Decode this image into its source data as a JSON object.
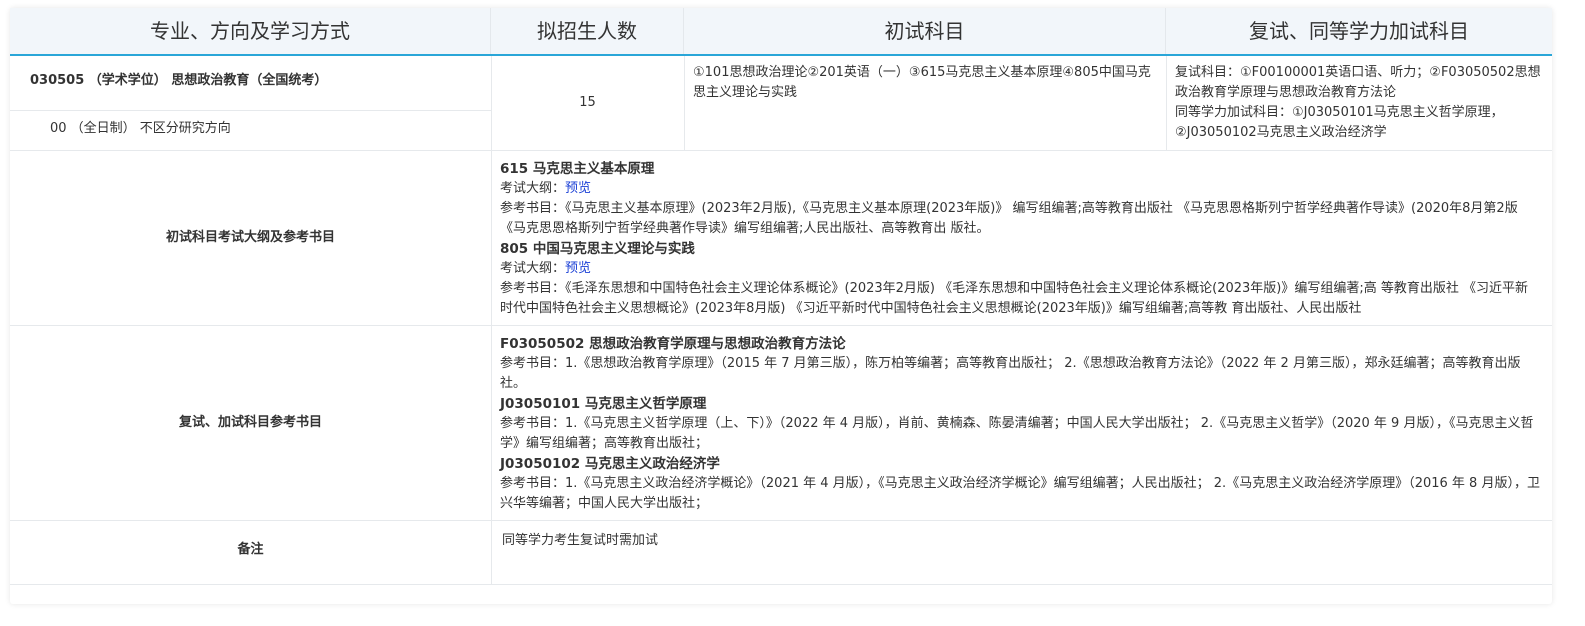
{
  "header": {
    "col1": "专业、方向及学习方式",
    "col2": "拟招生人数",
    "col3": "初试科目",
    "col4": "复试、同等学力加试科目"
  },
  "program": {
    "major": "030505 （学术学位） 思想政治教育（全国统考）",
    "direction": "00 （全日制） 不区分研究方向",
    "quota": "15",
    "exam_subjects": "①101思想政治理论②201英语（一）③615马克思主义基本原理④805中国马克思主义理论与实践",
    "retest_line1": "复试科目：①F00100001英语口语、听力；②F03050502思想政治教育学原理与思想政治教育方法论",
    "retest_line2": "同等学力加试科目：①J03050101马克思主义哲学原理，②J03050102马克思主义政治经济学"
  },
  "section1": {
    "label": "初试科目考试大纲及参考书目",
    "s1_title": "615 马克思主义基本原理",
    "s1_outline_label": "考试大纲：",
    "s1_outline_link": "预览",
    "s1_books": "参考书目：《马克思主义基本原理》(2023年2月版),《马克思主义基本原理(2023年版)》 编写组编著;高等教育出版社 《马克思恩格斯列宁哲学经典著作导读》(2020年8月第2版 《马克思恩格斯列宁哲学经典著作导读》编写组编著;人民出版社、高等教育出 版社。",
    "s2_title": "805 中国马克思主义理论与实践",
    "s2_outline_label": "考试大纲：",
    "s2_outline_link": "预览",
    "s2_books": "参考书目：《毛泽东思想和中国特色社会主义理论体系概论》(2023年2月版) 《毛泽东思想和中国特色社会主义理论体系概论(2023年版)》编写组编著;高 等教育出版社 《习近平新时代中国特色社会主义思想概论》(2023年8月版) 《习近平新时代中国特色社会主义思想概论(2023年版)》编写组编著;高等教 育出版社、人民出版社"
  },
  "section2": {
    "label": "复试、加试科目参考书目",
    "a_title": "F03050502 思想政治教育学原理与思想政治教育方法论",
    "a_books": "参考书目：1.《思想政治教育学原理》（2015 年 7 月第三版），陈万柏等编著；高等教育出版社； 2.《思想政治教育方法论》（2022 年 2 月第三版），郑永廷编著；高等教育出版社。",
    "b_title": "J03050101 马克思主义哲学原理",
    "b_books": "参考书目：1.《马克思主义哲学原理（上、下）》（2022 年 4 月版），肖前、黄楠森、陈晏清编著；中国人民大学出版社； 2.《马克思主义哲学》（2020 年 9 月版），《马克思主义哲学》编写组编著；高等教育出版社；",
    "c_title": "J03050102 马克思主义政治经济学",
    "c_books": "参考书目：1.《马克思主义政治经济学概论》（2021 年 4 月版），《马克思主义政治经济学概论》编写组编著；人民出版社； 2.《马克思主义政治经济学原理》（2016 年 8 月版），卫兴华等编著；中国人民大学出版社；"
  },
  "section3": {
    "label": "备注",
    "note": "同等学力考生复试时需加试"
  },
  "colors": {
    "header_bg": "#f2f6fa",
    "header_border": "#2aa6d8",
    "link": "#1a3fd6"
  }
}
